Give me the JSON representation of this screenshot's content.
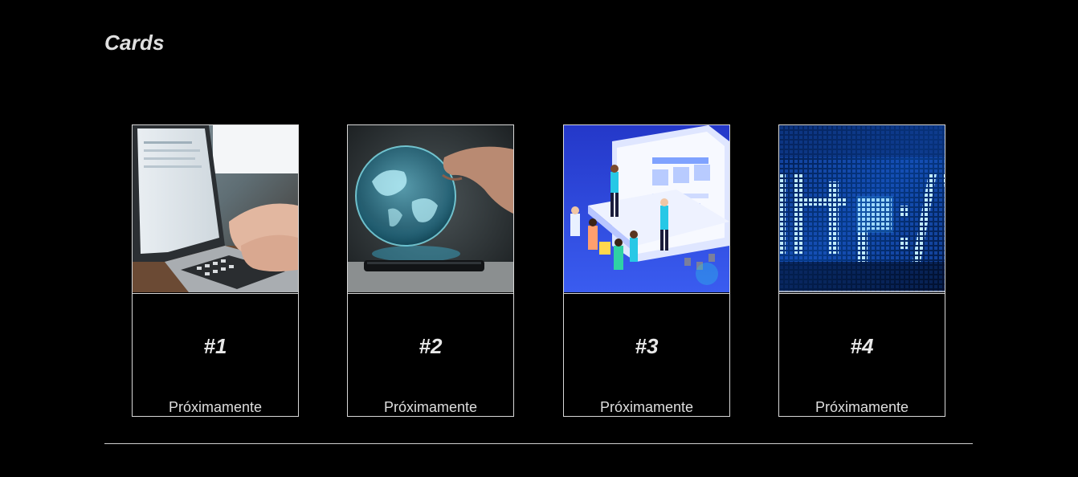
{
  "page": {
    "title": "Cards"
  },
  "cards": [
    {
      "number": "#1",
      "status": "Próximamente",
      "image": "laptop-typing-photo"
    },
    {
      "number": "#2",
      "status": "Próximamente",
      "image": "hologram-globe-phone-photo"
    },
    {
      "number": "#3",
      "status": "Próximamente",
      "image": "isometric-web-team-illustration"
    },
    {
      "number": "#4",
      "status": "Próximamente",
      "image": "http-led-screen-photo"
    }
  ],
  "colors": {
    "background": "#000000",
    "text": "#e6e6e6",
    "border": "#d8d8d8"
  }
}
